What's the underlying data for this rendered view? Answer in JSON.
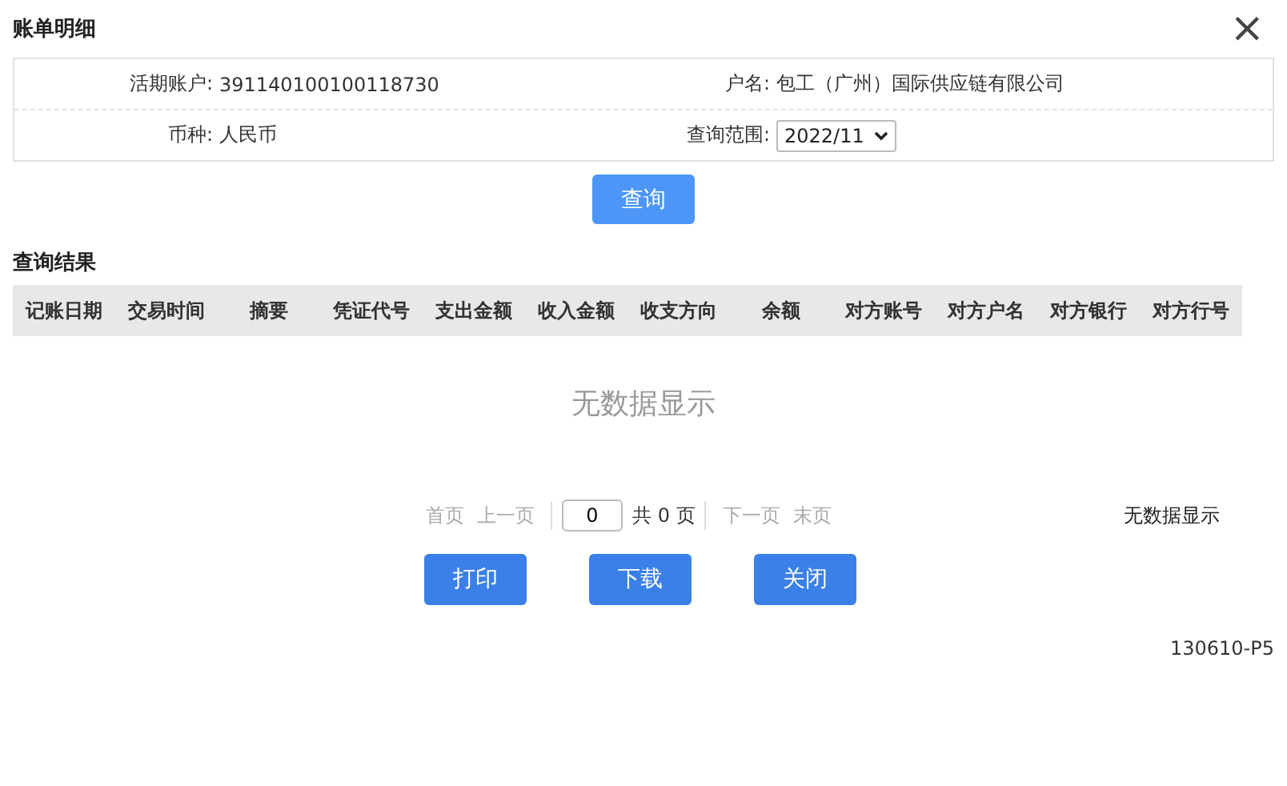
{
  "dialog": {
    "title": "账单明细",
    "close": "×"
  },
  "form": {
    "rows": [
      {
        "label": "活期账户:",
        "value": "391140100100118730",
        "label2": "户名:",
        "value2": "包工（广州）国际供应链有限公司",
        "kind": "text"
      },
      {
        "label": "币种:",
        "value": "人民币",
        "label2": "查询范围:",
        "value2": "2022/11",
        "kind": "select"
      }
    ]
  },
  "query_button": "查询",
  "results": {
    "title": "查询结果",
    "columns": [
      "记账日期",
      "交易时间",
      "摘要",
      "凭证代号",
      "支出金额",
      "收入金额",
      "收支方向",
      "余额",
      "对方账号",
      "对方户名",
      "对方银行",
      "对方行号"
    ],
    "empty": "无数据显示"
  },
  "pager": {
    "before": [
      {
        "label": "首页",
        "disabled": true
      },
      {
        "label": "上一页",
        "disabled": true
      }
    ],
    "page": "0",
    "total": "共 0 页",
    "after": [
      {
        "label": "下一页",
        "disabled": true
      },
      {
        "label": "末页",
        "disabled": true
      }
    ],
    "status": "无数据显示"
  },
  "buttons": [
    "打印",
    "下载",
    "关闭"
  ],
  "footer": "130610-P5"
}
